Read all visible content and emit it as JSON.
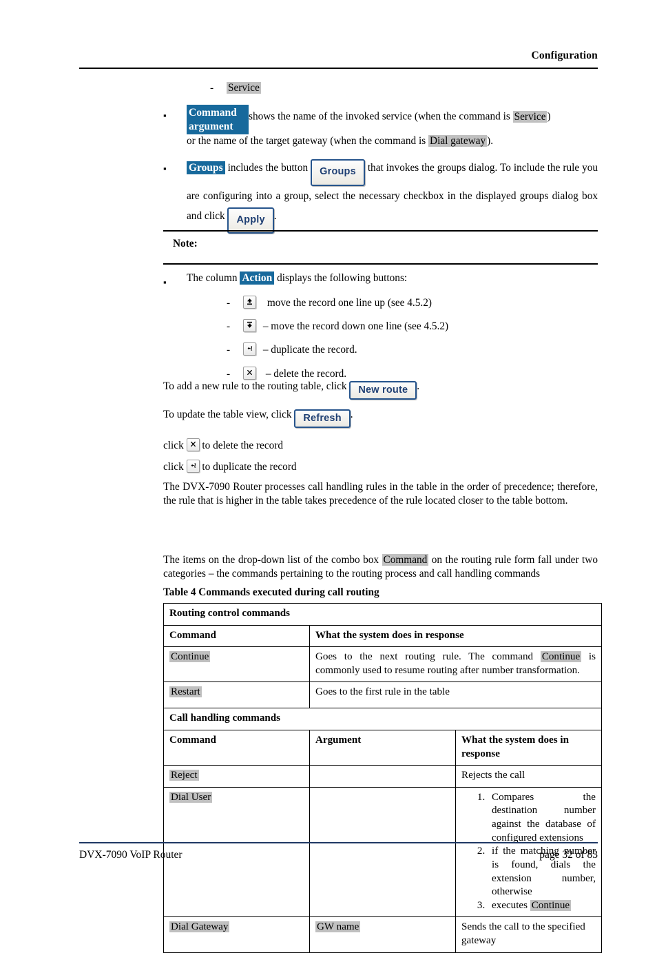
{
  "header": {
    "title": "Configuration"
  },
  "footer": {
    "left": "DVX-7090 VoIP Router",
    "right": "page 32 of 83"
  },
  "body": {
    "service_dash": "-",
    "service_label": "Service",
    "cmd_arg_label": "Command argument",
    "cmd_arg_text_1": "shows the name of the invoked service (when the command is",
    "cmd_arg_service": "Service",
    "cmd_arg_text_2": ")",
    "cmd_arg_text_3": "or the name of the target gateway (when the command is",
    "cmd_arg_dialgw": "Dial gateway",
    "cmd_arg_text_4": ").",
    "groups_label": "Groups",
    "groups_text_1": "includes the button",
    "groups_button": "Groups",
    "groups_text_2": "that invokes the groups dialog. To include the rule you are configuring into a group, select the necessary checkbox in the displayed groups dialog box and click",
    "apply_button": "Apply",
    "groups_text_3": ".",
    "note_label": "Note:",
    "action_text_1": "The column",
    "action_label": "Action",
    "action_text_2": "displays the following buttons:",
    "action_items": [
      {
        "dash": "-",
        "icon": "move-up-icon",
        "text": "move the record one line up (see 4.5.2)"
      },
      {
        "dash": "-",
        "icon": "move-down-icon",
        "text": "– move the record down one line (see 4.5.2)"
      },
      {
        "dash": "-",
        "icon": "duplicate-icon",
        "text": "– duplicate the record."
      },
      {
        "dash": "-",
        "icon": "delete-icon",
        "text": "– delete the record."
      }
    ],
    "newroute_text": "To add a new rule to the routing table, click",
    "newroute_button": "New route",
    "newroute_period": ".",
    "refresh_text": "To update the table view, click",
    "refresh_button": "Refresh",
    "refresh_period": ".",
    "click_delete_pre": "click",
    "click_delete_post": "to delete the record",
    "click_dup_pre": "click",
    "click_dup_post": "to duplicate the record",
    "precedence_para": "The DVX-7090 Router processes call handling rules in the table in the order of precedence; therefore, the rule that is higher in the table takes precedence of the rule located closer to the table bottom.",
    "combo_text_1": "The items on the drop-down list of the combo box",
    "combo_label": "Command",
    "combo_text_2": "on the routing rule form fall under two categories – the commands pertaining to the routing process and call handling commands"
  },
  "table4": {
    "caption": "Table 4 Commands executed during call routing",
    "section1": "Routing control commands",
    "headers1": {
      "command": "Command",
      "response": "What the system does in response"
    },
    "rows1": [
      {
        "command": "Continue",
        "response_pre": "Goes to the next routing rule. The command",
        "response_hl": "Continue",
        "response_post": "is commonly used to resume routing after number transformation."
      },
      {
        "command": "Restart",
        "response_pre": "Goes to the first rule in the table",
        "response_hl": "",
        "response_post": ""
      }
    ],
    "section2": "Call handling commands",
    "headers2": {
      "command": "Command",
      "argument": "Argument",
      "response": "What the system does in response"
    },
    "rows2": [
      {
        "command": "Reject",
        "argument": "",
        "response": "Rejects the call"
      },
      {
        "command": "Dial User",
        "argument": "",
        "steps": [
          "Compares the destination number against the database of configured extensions",
          "if the matching number is found, dials the extension number, otherwise",
          "executes "
        ],
        "step3_hl": "Continue"
      },
      {
        "command": "Dial Gateway",
        "argument": "GW name",
        "response": "Sends the call to the specified gateway"
      }
    ]
  },
  "colors": {
    "label_blue": "#17699c",
    "highlight_gray": "#c0c0c0",
    "button_border_blue": "#26548c",
    "button_text_blue": "#1f3f73",
    "footer_rule": "#1f3864"
  }
}
